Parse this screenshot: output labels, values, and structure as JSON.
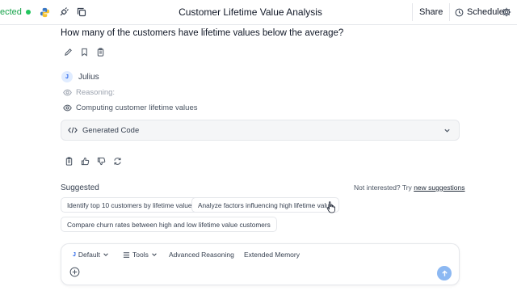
{
  "topbar": {
    "connection_status": "ected",
    "title": "Customer Lifetime Value Analysis",
    "share_label": "Share",
    "schedule_label": "Schedule"
  },
  "chat": {
    "question": "How many of the customers have lifetime values below the average?",
    "assistant_initial": "J",
    "assistant_name": "Julius",
    "reasoning_label": "Reasoning:",
    "computing_label": "Computing customer lifetime values",
    "code_label": "Generated Code"
  },
  "suggestions": {
    "heading": "Suggested",
    "not_interested": "Not interested? Try",
    "new_suggestions": "new suggestions",
    "items": [
      "Identify top 10 customers by lifetime value",
      "Analyze factors influencing high lifetime value",
      "Compare churn rates between high and low lifetime value customers"
    ]
  },
  "composer": {
    "model_initial": "J",
    "model_label": "Default",
    "tools_label": "Tools",
    "advanced_reasoning": "Advanced Reasoning",
    "extended_memory": "Extended Memory"
  },
  "colors": {
    "status_green": "#22c55e",
    "avatar_blue": "#2563eb",
    "send_button": "#8cb8f2"
  }
}
